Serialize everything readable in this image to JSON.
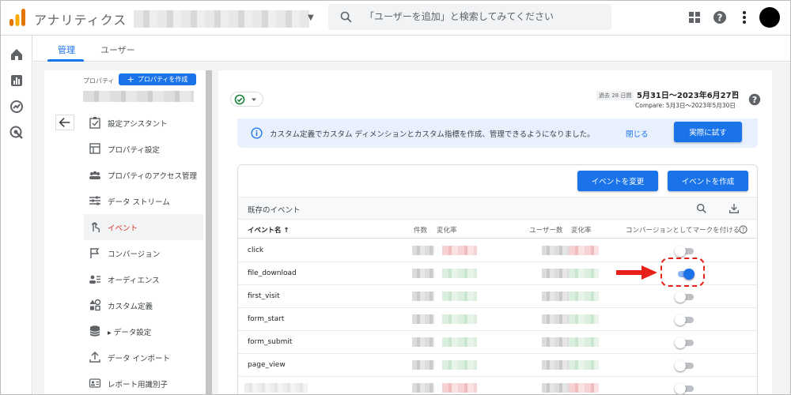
{
  "app": {
    "title": "アナリティクス",
    "search_placeholder": "「ユーザーを追加」と検索してみてください"
  },
  "tabs": [
    {
      "label": "管理",
      "active": true
    },
    {
      "label": "ユーザー",
      "active": false
    }
  ],
  "property": {
    "label": "プロパティ",
    "create_button": "プロパティを作成"
  },
  "menu": [
    {
      "label": "設定アシスタント",
      "icon": "checklist-icon",
      "active": false
    },
    {
      "label": "プロパティ設定",
      "icon": "layout-icon",
      "active": false
    },
    {
      "label": "プロパティのアクセス管理",
      "icon": "people-icon",
      "active": false
    },
    {
      "label": "データ ストリーム",
      "icon": "streams-icon",
      "active": false
    },
    {
      "label": "イベント",
      "icon": "touch-icon",
      "active": true
    },
    {
      "label": "コンバージョン",
      "icon": "flag-icon",
      "active": false
    },
    {
      "label": "オーディエンス",
      "icon": "audience-icon",
      "active": false
    },
    {
      "label": "カスタム定義",
      "icon": "shapes-icon",
      "active": false
    },
    {
      "label": "▸ データ設定",
      "icon": "database-icon",
      "active": false
    },
    {
      "label": "データ インポート",
      "icon": "upload-icon",
      "active": false
    },
    {
      "label": "レポート用識別子",
      "icon": "id-icon",
      "active": false
    }
  ],
  "header": {
    "date_prefix": "過去 28 日間",
    "date_range": "5月31日～2023年6月27日",
    "compare": "Compare: 5月3日～2023年5月30日"
  },
  "banner": {
    "text": "カスタム定義でカスタム ディメンションとカスタム指標を作成、管理できるようになりました。",
    "close": "閉じる",
    "try": "実際に試す"
  },
  "events_card": {
    "modify_button": "イベントを変更",
    "create_button": "イベントを作成",
    "section_title": "既存のイベント",
    "columns": {
      "name": "イベント名 ↑",
      "count": "件数",
      "count_change": "変化率",
      "users": "ユーザー数",
      "users_change": "変化率",
      "conversion": "コンバージョンとしてマークを付ける"
    },
    "rows": [
      {
        "name": "click",
        "conversion": false,
        "trend": "red"
      },
      {
        "name": "file_download",
        "conversion": true,
        "trend": "green"
      },
      {
        "name": "first_visit",
        "conversion": false,
        "trend": "green"
      },
      {
        "name": "form_start",
        "conversion": false,
        "trend": "green"
      },
      {
        "name": "form_submit",
        "conversion": false,
        "trend": "green"
      },
      {
        "name": "page_view",
        "conversion": false,
        "trend": "green"
      },
      {
        "name": "",
        "conversion": false,
        "trend": "red"
      }
    ]
  },
  "colors": {
    "accent": "#1a73e8",
    "active_menu": "#d93025",
    "annotation": "#e8201a"
  }
}
